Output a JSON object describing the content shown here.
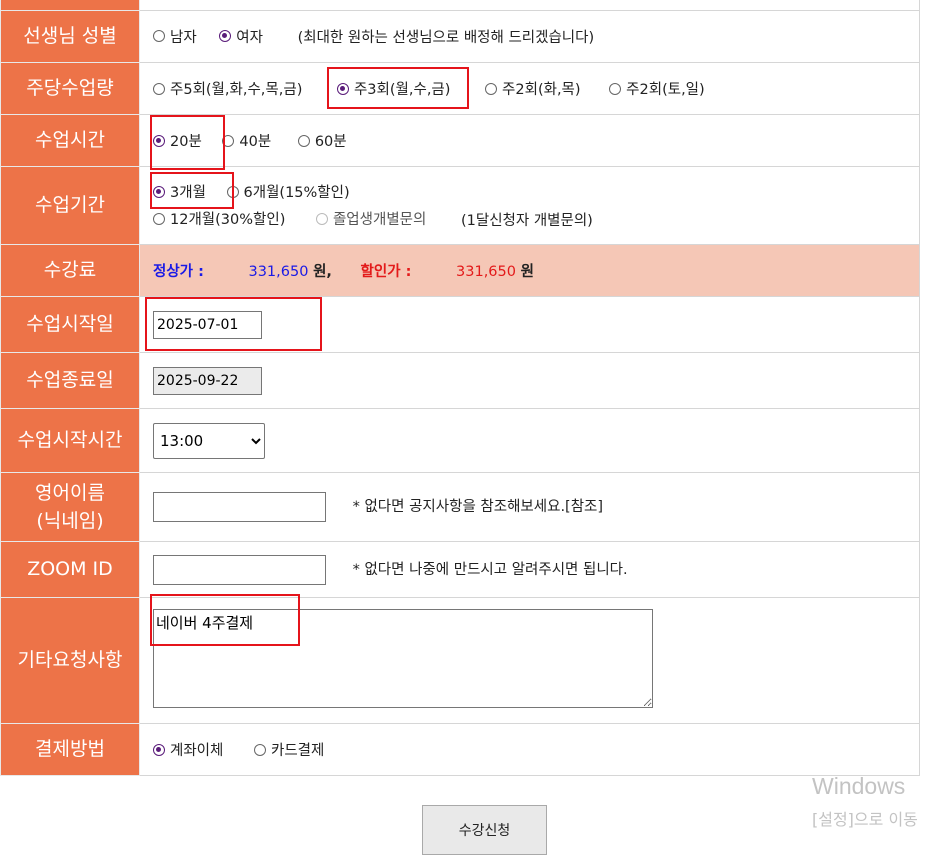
{
  "rows": {
    "teacher_gender": {
      "label": "선생님 성별",
      "options": [
        "남자",
        "여자"
      ],
      "selected": "여자",
      "note": "(최대한 원하는 선생님으로 배정해 드리겠습니다)"
    },
    "weekly_amount": {
      "label": "주당수업량",
      "options": [
        "주5회(월,화,수,목,금)",
        "주3회(월,수,금)",
        "주2회(화,목)",
        "주2회(토,일)"
      ],
      "selected": "주3회(월,수,금)"
    },
    "class_time": {
      "label": "수업시간",
      "options": [
        "20분",
        "40분",
        "60분"
      ],
      "selected": "20분"
    },
    "class_period": {
      "label": "수업기간",
      "options": [
        "3개월",
        "6개월(15%할인)",
        "12개월(30%할인)",
        "졸업생개별문의"
      ],
      "selected": "3개월",
      "note": "(1달신청자 개별문의)"
    },
    "fee": {
      "label": "수강료",
      "normal_label": "정상가 :",
      "normal_value": "331,650",
      "sale_label": "할인가 :",
      "sale_value": "331,650",
      "won": "원",
      "won_comma": "원,"
    },
    "start_date": {
      "label": "수업시작일",
      "value": "2025-07-01"
    },
    "end_date": {
      "label": "수업종료일",
      "value": "2025-09-22"
    },
    "start_time": {
      "label": "수업시작시간",
      "value": "13:00"
    },
    "english_name": {
      "label_line1": "영어이름",
      "label_line2": "(닉네임)",
      "value": "",
      "note": "* 없다면 공지사항을 참조해보세요.[참조]"
    },
    "zoom_id": {
      "label": "ZOOM ID",
      "value": "",
      "note": "* 없다면 나중에 만드시고 알려주시면 됩니다."
    },
    "other_requests": {
      "label": "기타요청사항",
      "value": "네이버 4주결제"
    },
    "payment": {
      "label": "결제방법",
      "options": [
        "계좌이체",
        "카드결제"
      ],
      "selected": "계좌이체"
    }
  },
  "submit_label": "수강신청",
  "watermark": {
    "line1": "Windows",
    "line2": "[설정]으로 이동"
  },
  "colors": {
    "label_bg": "#ed7348",
    "fee_bg": "#f5c7b6",
    "highlight": "#e5141b",
    "radio": "#5a1c7a"
  }
}
